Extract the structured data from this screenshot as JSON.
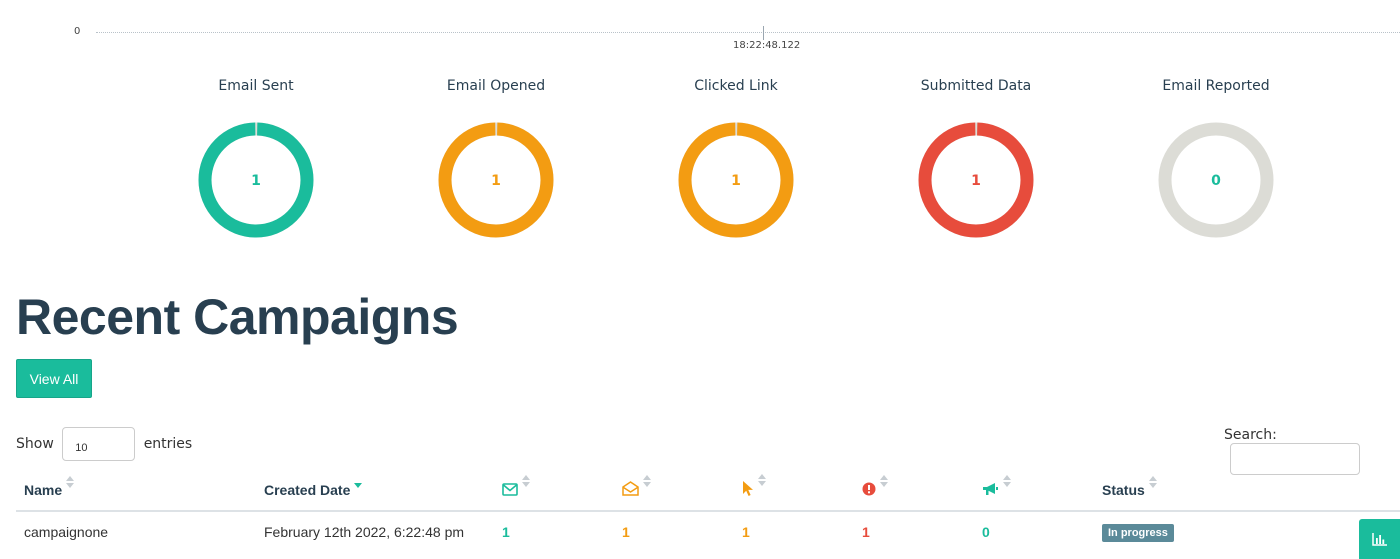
{
  "timeline": {
    "y_axis_label": "%",
    "y_tick": "0",
    "x_tick": "18:22:48.122"
  },
  "stats": [
    {
      "title": "Email Sent",
      "value": "1",
      "color": "#1abc9c",
      "fraction": 1.0
    },
    {
      "title": "Email Opened",
      "value": "1",
      "color": "#f39c12",
      "fraction": 1.0
    },
    {
      "title": "Clicked Link",
      "value": "1",
      "color": "#f39c12",
      "fraction": 1.0
    },
    {
      "title": "Submitted Data",
      "value": "1",
      "color": "#e74c3c",
      "fraction": 1.0
    },
    {
      "title": "Email Reported",
      "value": "0",
      "color": "#1abc9c",
      "fraction": 0.0
    }
  ],
  "track_color": "#dcdcd6",
  "heading": "Recent Campaigns",
  "view_all_label": "View All",
  "table_controls": {
    "show_label": "Show",
    "entries_value": "10",
    "entries_label": "entries",
    "search_label": "Search:"
  },
  "table": {
    "columns": {
      "name": "Name",
      "created_date": "Created Date",
      "sent_icon": "envelope-icon",
      "opened_icon": "envelope-open-icon",
      "clicked_icon": "mouse-pointer-icon",
      "submitted_icon": "exclamation-circle-icon",
      "reported_icon": "bullhorn-icon",
      "status": "Status"
    },
    "rows": [
      {
        "name": "campaignone",
        "created_date": "February 12th 2022, 6:22:48 pm",
        "sent": "1",
        "opened": "1",
        "clicked": "1",
        "submitted": "1",
        "reported": "0",
        "status": "In progress"
      }
    ]
  },
  "colors": {
    "accent": "#1abc9c",
    "warning": "#f39c12",
    "danger": "#e74c3c",
    "status_badge": "#5b8a99"
  },
  "results_button_icon": "bar-chart-icon"
}
